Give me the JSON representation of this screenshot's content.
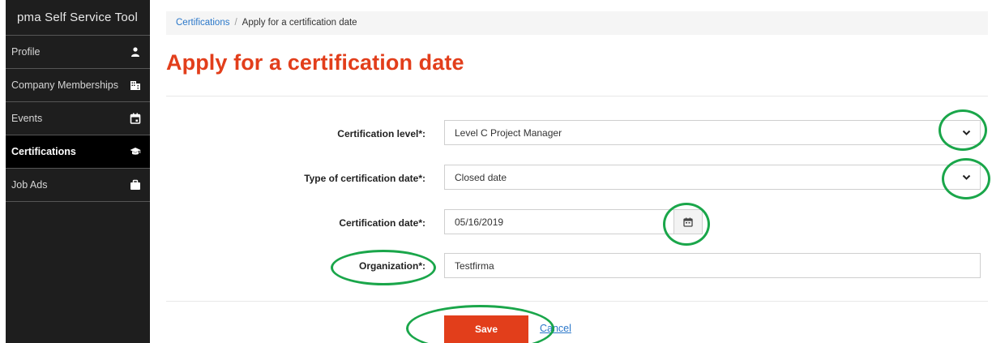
{
  "sidebar": {
    "title": "pma Self Service Tool",
    "items": [
      {
        "label": "Profile",
        "icon": "person-icon"
      },
      {
        "label": "Company Memberships",
        "icon": "building-icon"
      },
      {
        "label": "Events",
        "icon": "calendar-icon"
      },
      {
        "label": "Certifications",
        "icon": "graduation-cap-icon",
        "active": true
      },
      {
        "label": "Job Ads",
        "icon": "briefcase-icon"
      }
    ]
  },
  "breadcrumb": {
    "link": "Certifications",
    "separator": "/",
    "current": "Apply for a certification date"
  },
  "page_title": "Apply for a certification date",
  "form": {
    "certification_level": {
      "label": "Certification level*:",
      "value": "Level C Project Manager"
    },
    "date_type": {
      "label": "Type of certification date*:",
      "value": "Closed date"
    },
    "certification_date": {
      "label": "Certification date*:",
      "value": "05/16/2019"
    },
    "organization": {
      "label": "Organization*:",
      "value": "Testfirma"
    }
  },
  "actions": {
    "save": "Save",
    "cancel": "Cancel"
  },
  "colors": {
    "accent": "#e23e1b",
    "link": "#2a77c9",
    "annotation": "#1aa64a",
    "sidebar_bg": "#1e1e1e"
  }
}
